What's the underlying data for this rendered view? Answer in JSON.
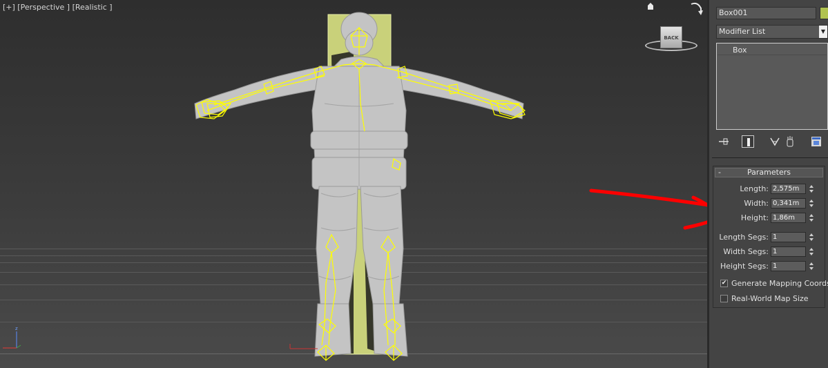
{
  "viewport": {
    "label": "[+] [Perspective ] [Realistic ]",
    "viewcube_face": "BACK",
    "axis_label": "z"
  },
  "command_panel": {
    "object_name": "Box001",
    "object_color": "#b0c24f",
    "modifier_list": "Modifier List",
    "modifier_stack": [
      "Box"
    ],
    "toolbar_icons": [
      "pin-stack-icon",
      "show-end-result-icon",
      "make-unique-icon",
      "remove-modifier-icon",
      "configure-modifier-sets-icon"
    ],
    "rollout": {
      "title": "Parameters",
      "collapse_symbol": "-",
      "params": [
        {
          "label": "Length:",
          "value": "2,575m"
        },
        {
          "label": "Width:",
          "value": "0,341m"
        },
        {
          "label": "Height:",
          "value": "1,86m"
        }
      ],
      "segs": [
        {
          "label": "Length Segs:",
          "value": "1"
        },
        {
          "label": "Width Segs:",
          "value": "1"
        },
        {
          "label": "Height Segs:",
          "value": "1"
        }
      ],
      "generate_mapping": {
        "label": "Generate Mapping Coords.",
        "checked": true,
        "mark": "✔"
      },
      "real_world": {
        "label": "Real-World Map Size",
        "checked": false,
        "mark": ""
      }
    }
  },
  "colors": {
    "bone_yellow": "#ffff00",
    "box_green": "#c9d17a",
    "annotation_red": "#ff0000"
  }
}
